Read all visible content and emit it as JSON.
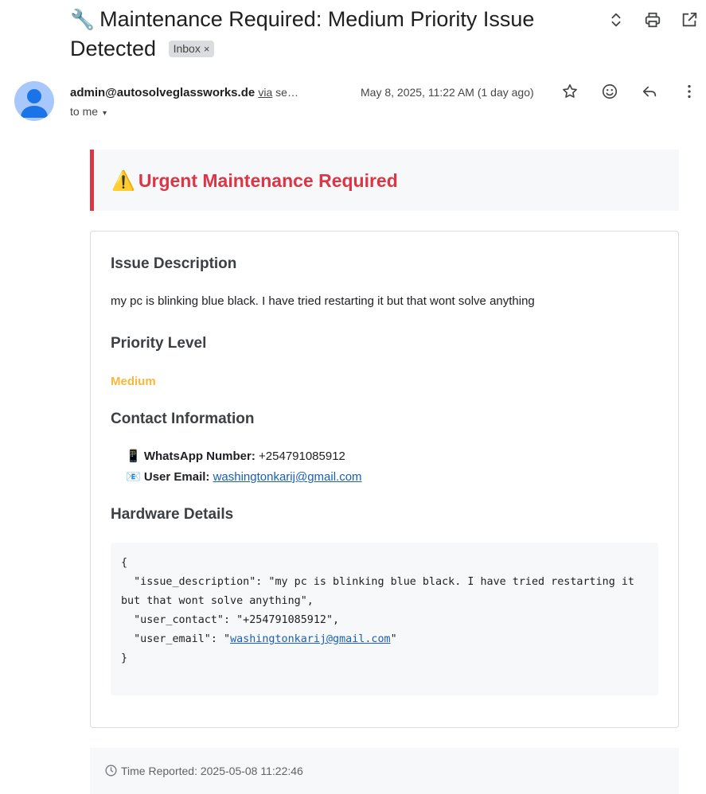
{
  "subject": {
    "icon": "wrench-icon",
    "emoji": "🔧",
    "text": "Maintenance Required: Medium Priority Issue Detected",
    "label_chip": "Inbox",
    "chip_close": "×"
  },
  "header_icons": [
    "expand-collapse-icon",
    "print-icon",
    "open-in-new-window-icon"
  ],
  "message": {
    "sender_name": "admin@autosolveglassworks.de",
    "via_label": "via",
    "via_service": "se…",
    "date": "May 8, 2025, 11:22 AM (1 day ago)",
    "to": "to me",
    "caret": "▾",
    "action_icons": [
      "star-icon",
      "emoji-react-icon",
      "reply-icon",
      "more-vert-icon"
    ]
  },
  "email": {
    "banner_emoji": "⚠️",
    "banner_title": "Urgent Maintenance Required",
    "issue_heading": "Issue Description",
    "issue_text": "my pc is blinking blue black. I have tried restarting it but that wont solve anything",
    "priority_heading": "Priority Level",
    "priority_value": "Medium",
    "contact_heading": "Contact Information",
    "whatsapp_emoji": "📱",
    "whatsapp_label": "WhatsApp Number:",
    "whatsapp_value": "+254791085912",
    "email_emoji": "📧",
    "email_label": "User Email:",
    "email_value": "washingtonkarij@gmail.com",
    "hardware_heading": "Hardware Details",
    "json_open": "{",
    "json_line1": "  \"issue_description\": \"my pc is blinking blue black. I have tried restarting it but that wont solve anything\",",
    "json_line2": "  \"user_contact\": \"+254791085912\",",
    "json_line3_prefix": "  \"user_email\": \"",
    "json_line3_link": "washingtonkarij@gmail.com",
    "json_line3_suffix": "\"",
    "json_close": "}",
    "time_reported": "Time Reported: 2025-05-08 11:22:46"
  },
  "colors": {
    "accent_red": "#dc3545",
    "priority_medium": "#f6b93b",
    "link": "#1a5fb4",
    "avatar_bg": "#a8c7fa",
    "avatar_fg": "#1a73e8"
  }
}
